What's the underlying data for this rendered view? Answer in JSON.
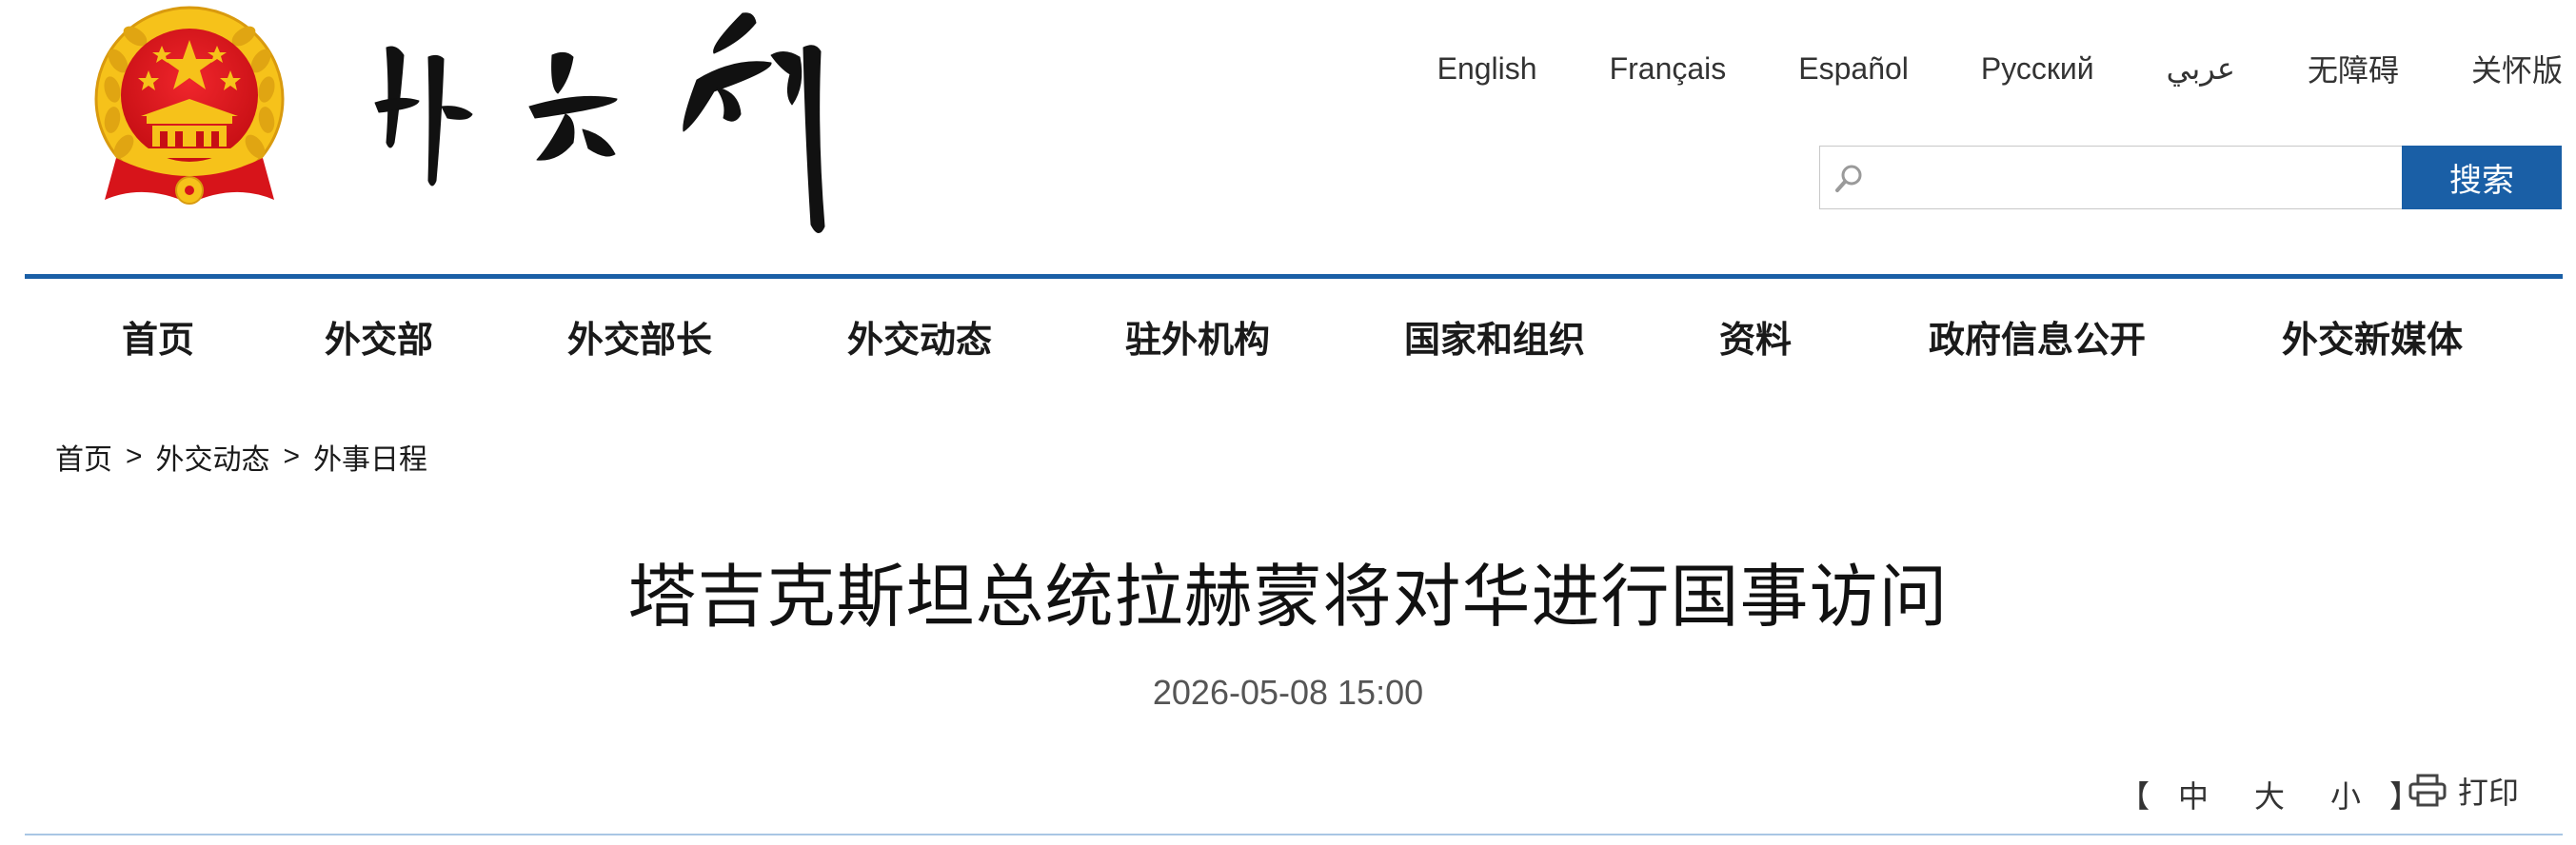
{
  "header": {
    "languages": [
      "English",
      "Français",
      "Español",
      "Русский",
      "عربي",
      "无障碍",
      "关怀版"
    ],
    "search": {
      "placeholder": "",
      "button_label": "搜索"
    }
  },
  "nav": {
    "items": [
      "首页",
      "外交部",
      "外交部长",
      "外交动态",
      "驻外机构",
      "国家和组织",
      "资料",
      "政府信息公开",
      "外交新媒体"
    ]
  },
  "breadcrumb": {
    "items": [
      "首页",
      "外交动态",
      "外事日程"
    ],
    "separator": ">"
  },
  "article": {
    "title": "塔吉克斯坦总统拉赫蒙将对华进行国事访问",
    "date": "2026-05-08 15:00"
  },
  "tools": {
    "bracket_open": "【",
    "bracket_close": "】",
    "font_sizes": [
      "中",
      "大",
      "小"
    ],
    "print_label": "打印"
  },
  "colors": {
    "accent_blue": "#1a5fa6",
    "emblem_red": "#d7141a",
    "emblem_gold": "#f6c21a"
  },
  "icons": {
    "emblem": "national-emblem-icon",
    "search": "search-icon",
    "print": "printer-icon"
  }
}
